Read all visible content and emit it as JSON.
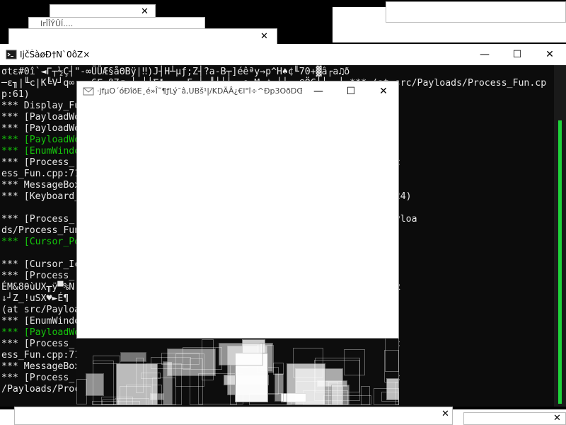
{
  "background_windows": {
    "top_left_title": "IrÎÎÝÛÍ....",
    "close_glyph": "✕"
  },
  "console_window": {
    "title": "IjčŠàøÐ†N`0ôZ×",
    "minimize": "—",
    "maximize": "☐",
    "close": "✕",
    "lines": [
      {
        "text": "σtε#0î`◄Γ┬½Ç┤\"-∞ÜÜÆ§åΘBÿ|‼)J┤H┴µƒ;Z┤?a-B┬]éêªy→p^H♠¢╙70+▓â┌a♫ð",
        "color": "white"
      },
      {
        "text": "─ε╖|╙c|K╚V┘q∞ ╔ 6Γ ß7σ⌐┤ ┼╧ΣΦ ∞ .F╓╞ ╠┼╛│╕,∩ M ¢ ┴┘═┌@ÖC├┤  ┘ *** (at src/Payloads/Process_Fun.cp",
        "color": "white"
      },
      {
        "text": "p:61)",
        "color": "white"
      },
      {
        "text": "*** Display_Fu                              PayloadMan.cpp:140)",
        "color": "white"
      },
      {
        "text": "*** [PayloadWo                              yloadMan.cpp:128)",
        "color": "white"
      },
      {
        "text": "*** [PayloadWo                              yloadMan.cpp:128)",
        "color": "white"
      },
      {
        "text": "*** [PayloadWo                              yloadMan.cpp:128)",
        "color": "green"
      },
      {
        "text": "*** [EnumWindo                              ss_Fun.cpp:40)",
        "color": "green"
      },
      {
        "text": "*** [Process_                               ) *** (at src/Payloads/Proc",
        "color": "white"
      },
      {
        "text": "ess_Fun.cpp:71",
        "color": "white"
      },
      {
        "text": "*** MessageBox                              PayloadMan.cpp:140)",
        "color": "white"
      },
      {
        "text": "*** [Keyboard_                              loads/Keyboard_Rapist.cpp:24)",
        "color": "white"
      },
      {
        "text": "",
        "color": "white"
      },
      {
        "text": "*** [Process_                               Broker.exe! *** (at src/Payloa",
        "color": "white"
      },
      {
        "text": "ds/Process_Fun",
        "color": "white"
      },
      {
        "text": "*** [Cursor_Po                              PayLoads/Cursor_Fun.cpp:45)",
        "color": "green"
      },
      {
        "text": "",
        "color": "white"
      },
      {
        "text": "*** [Cursor_Ic                              Icon_Fun.cpp:56)",
        "color": "white"
      },
      {
        "text": "*** [Process_                               Γ┐¼┤σ^┤â┘↑ü‡,áG┘\\'G\\|%8d3B",
        "color": "white"
      },
      {
        "text": "ÉM&8θùUX╥ÿ▀%N                                â|┤αQ↔Zn6б1♫î╧ÑC¥|/âi│Tå┤α",
        "color": "white"
      },
      {
        "text": "↓┘Z_!uSX♥►É¶                                 ;è╙§s0s▄r│┌θ|á{‼|B0_/ ***",
        "color": "white"
      },
      {
        "text": "(at src/Payloa",
        "color": "white"
      },
      {
        "text": "*** [EnumWindo                              _Fun.cpp:30)",
        "color": "white"
      },
      {
        "text": "*** [PayloadWo                              yloadMan.cpp:128)",
        "color": "green"
      },
      {
        "text": "*** [Process_                               ) *** (at src/Payloads/Proc",
        "color": "white"
      },
      {
        "text": "ess_Fun.cpp:71",
        "color": "white"
      },
      {
        "text": "*** MessageBox                              PayloadMan.cpp:140)",
        "color": "white"
      },
      {
        "text": "*** [Process_                               timeBroker.exe! *** (at src",
        "color": "white"
      },
      {
        "text": "/Payloads/Proc",
        "color": "white"
      }
    ]
  },
  "popup_window": {
    "title": "·jfµO´óÐîöE¸é»Î˜¶ƒLý¯â,UBš¹|/KDÄÂ¿€l\"î÷^Ðp3OðDŒ...",
    "minimize": "—",
    "maximize": "☐",
    "close": "✕"
  },
  "colors": {
    "console_bg": "#0c0c0c",
    "console_text": "#e8e8e8",
    "console_green": "#16c60c",
    "scrollbar_thumb": "#1dd43a"
  }
}
